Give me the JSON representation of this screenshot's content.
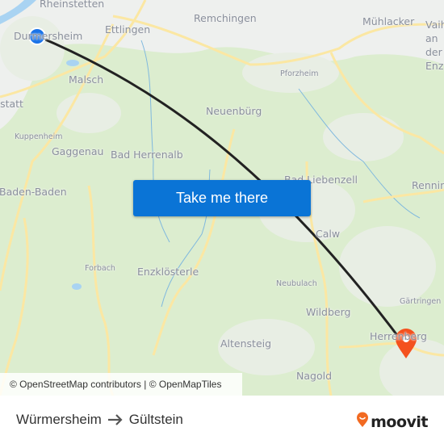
{
  "map": {
    "places": [
      {
        "name": "Rheinstetten",
        "size": "lg"
      },
      {
        "name": "Durmersheim",
        "size": "lg"
      },
      {
        "name": "Ettlingen",
        "size": "lg"
      },
      {
        "name": "Remchingen",
        "size": "lg"
      },
      {
        "name": "Mühlacker",
        "size": "lg"
      },
      {
        "name": "Vaihingen an der Enz",
        "size": "lg"
      },
      {
        "name": "Malsch",
        "size": "lg"
      },
      {
        "name": "Pforzheim",
        "size": "sm"
      },
      {
        "name": "Rastatt",
        "size": "lg"
      },
      {
        "name": "Neuenbürg",
        "size": "lg"
      },
      {
        "name": "Kuppenheim",
        "size": "sm"
      },
      {
        "name": "Gaggenau",
        "size": "lg"
      },
      {
        "name": "Bad Herrenalb",
        "size": "lg"
      },
      {
        "name": "Bad Liebenzell",
        "size": "lg"
      },
      {
        "name": "Baden-Baden",
        "size": "lg"
      },
      {
        "name": "Renningen",
        "size": "lg"
      },
      {
        "name": "Calw",
        "size": "lg"
      },
      {
        "name": "Forbach",
        "size": "sm"
      },
      {
        "name": "Enzklösterle",
        "size": "lg"
      },
      {
        "name": "Neubulach",
        "size": "sm"
      },
      {
        "name": "Gärtringen",
        "size": "sm"
      },
      {
        "name": "Wildberg",
        "size": "lg"
      },
      {
        "name": "Herrenberg",
        "size": "lg"
      },
      {
        "name": "Altensteig",
        "size": "lg"
      },
      {
        "name": "Nagold",
        "size": "lg"
      }
    ],
    "origin_marker": {
      "label": "Würmersheim",
      "color": "#1a73e8"
    },
    "destination_marker": {
      "label": "Gültstein",
      "color": "#f4511e"
    },
    "route_color": "#222222",
    "cta_label": "Take me there",
    "attribution": "© OpenStreetMap contributors | © OpenMapTiles"
  },
  "footer": {
    "origin": "Würmersheim",
    "destination": "Gültstein",
    "arrow_icon": "arrow-right-icon",
    "brand": "moovit",
    "brand_color": "#f26a21"
  }
}
